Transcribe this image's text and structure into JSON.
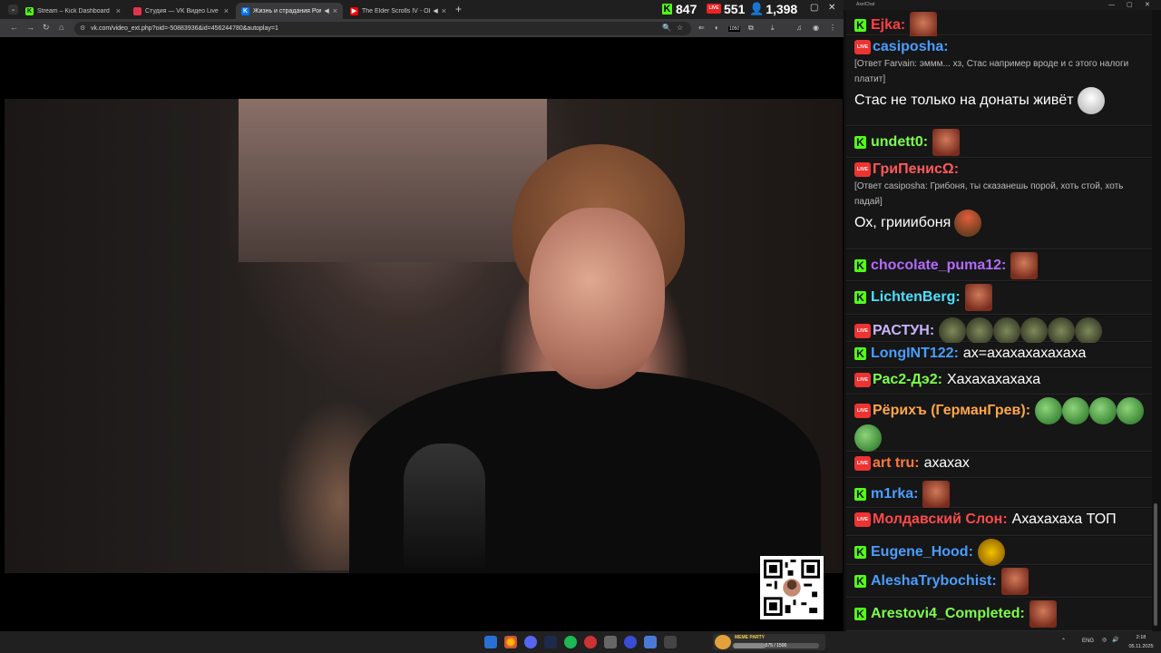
{
  "browser": {
    "tabs": [
      {
        "title": "Stream – Kick Dashboard",
        "icon": "kick-icon",
        "color": "#53fc18"
      },
      {
        "title": "Студия — VK Видео Live",
        "icon": "vk-live-icon",
        "color": "#e3334a"
      },
      {
        "title": "Жизнь и страдания Романа",
        "icon": "vk-icon",
        "color": "#0077ff",
        "active": true,
        "muted_icon": "speaker-icon"
      },
      {
        "title": "The Elder Scrolls IV - Oblivi",
        "icon": "youtube-icon",
        "color": "#ff0000",
        "muted_icon": "speaker-icon"
      }
    ],
    "counters": {
      "kick": "847",
      "vk_live": "551",
      "total": "1,398"
    },
    "url": "vk.com/video_ext.php?oid=-50883936&id=456244780&autoplay=1",
    "extension_badge": "1050"
  },
  "chat": {
    "window_title": "AxelChat",
    "messages": [
      {
        "platform": "kick",
        "user": "Ejka:",
        "color": "#ff4040",
        "text": "",
        "emotes": [
          "face"
        ]
      },
      {
        "platform": "vk",
        "user": "casiposha:",
        "color": "#4a9eff",
        "reply": "[Ответ Farvain: эммм... хз, Стас например вроде и с этого налоги платит]",
        "text": "Стас не только на донаты живёт",
        "emotes": [
          "trollface"
        ]
      },
      {
        "platform": "kick",
        "user": "undett0:",
        "color": "#7cff4a",
        "text": "",
        "emotes": [
          "face"
        ]
      },
      {
        "platform": "vk",
        "user": "ГриПенисΩ:",
        "color": "#ff5a5a",
        "reply": "[Ответ casiposha: Грибоня, ты сказанешь порой, хоть стой, хоть падай]",
        "text": "Ох, грииибоня",
        "emotes": [
          "mushroom"
        ]
      },
      {
        "platform": "kick",
        "user": "chocolate_puma12:",
        "color": "#b36bff",
        "text": "",
        "emotes": [
          "face"
        ]
      },
      {
        "platform": "kick",
        "user": "LichtenBerg:",
        "color": "#4ae0ff",
        "text": "",
        "emotes": [
          "face"
        ]
      },
      {
        "platform": "vk",
        "user": "РАСТУН:",
        "color": "#c9b3ff",
        "text": "",
        "emotes": [
          "pepe-small",
          "pepe-small",
          "pepe-small",
          "pepe-small",
          "pepe-small",
          "pepe-small"
        ]
      },
      {
        "platform": "kick",
        "user": "LongINT122:",
        "color": "#4a9eff",
        "text": "ах=ахахахахахаха",
        "emotes": []
      },
      {
        "platform": "vk",
        "user": "Рас2-Дэ2:",
        "color": "#7cff4a",
        "text": "Хахахахахаха",
        "emotes": []
      },
      {
        "platform": "vk",
        "user": "Рёрихъ (ГерманГрев):",
        "color": "#ffa64a",
        "text": "",
        "emotes": [
          "frog",
          "frog",
          "frog",
          "frog",
          "frog"
        ]
      },
      {
        "platform": "vk",
        "user": "art tru:",
        "color": "#ff7a3a",
        "text": "ахахах",
        "emotes": []
      },
      {
        "platform": "kick",
        "user": "m1rka:",
        "color": "#4a9eff",
        "text": "",
        "emotes": [
          "face"
        ]
      },
      {
        "platform": "vk",
        "user": "Молдавский Слон:",
        "color": "#ff4a4a",
        "text": "Ахахахаха ТОП",
        "emotes": []
      },
      {
        "platform": "kick",
        "user": "Eugene_Hood:",
        "color": "#4a9eff",
        "text": "",
        "emotes": [
          "cat"
        ]
      },
      {
        "platform": "kick",
        "user": "AleshaTrybochist:",
        "color": "#4a9eff",
        "text": "",
        "emotes": [
          "face"
        ]
      },
      {
        "platform": "kick",
        "user": "Arestovi4_Completed:",
        "color": "#7cff4a",
        "text": "",
        "emotes": [
          "face"
        ]
      }
    ]
  },
  "taskbar": {
    "widget_title": "MEME PARTY",
    "widget_progress_label": "575 / 1500",
    "widget_progress": 0.38,
    "lang": "ENG",
    "time": "2:18",
    "date": "05.11.2025"
  }
}
